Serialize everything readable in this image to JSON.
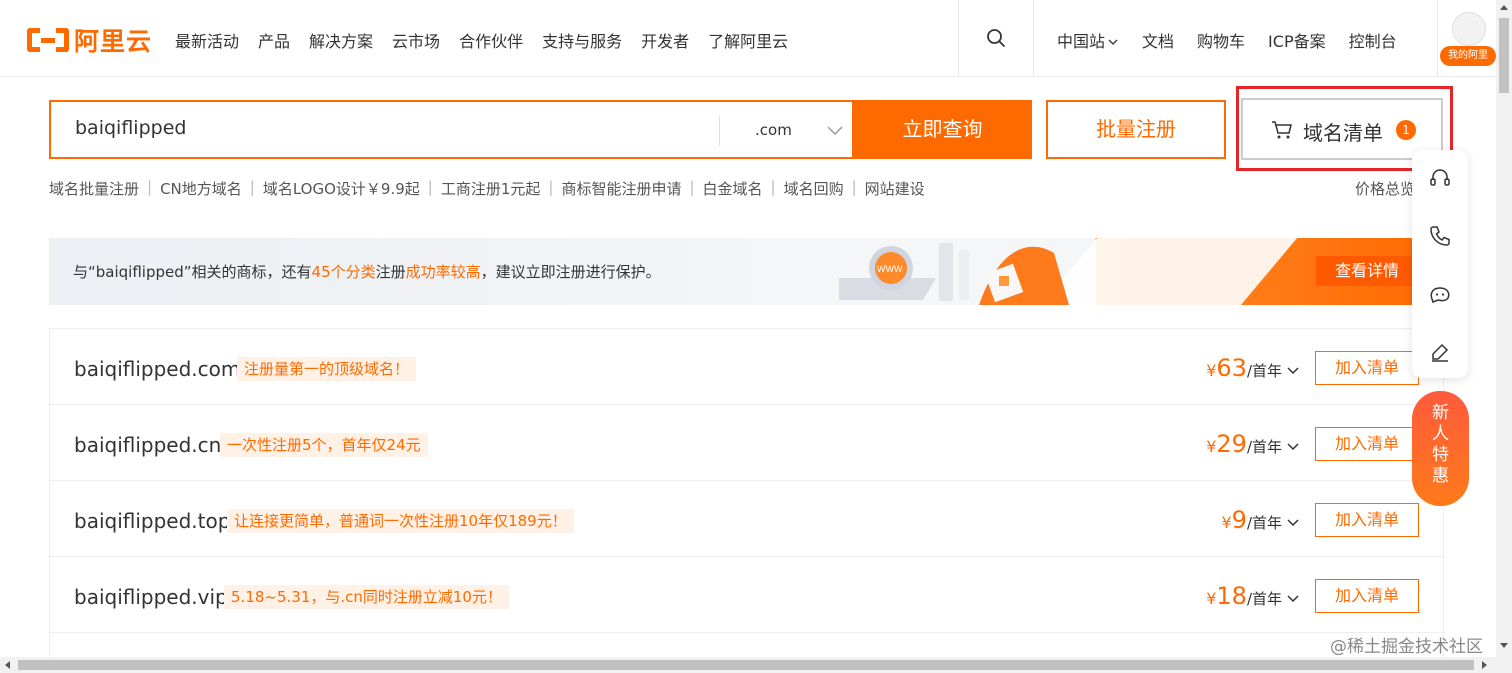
{
  "header": {
    "logo_text": "阿里云",
    "nav": [
      "最新活动",
      "产品",
      "解决方案",
      "云市场",
      "合作伙伴",
      "支持与服务",
      "开发者",
      "了解阿里云"
    ],
    "right_nav": [
      "中国站",
      "文档",
      "购物车",
      "ICP备案",
      "控制台"
    ],
    "avatar_badge": "我的阿里"
  },
  "search": {
    "value": "baiqiflipped",
    "suffix": ".com",
    "query_button": "立即查询",
    "batch_button": "批量注册",
    "list_button": "域名清单",
    "list_count": "1"
  },
  "links": [
    "域名批量注册",
    "CN地方域名",
    "域名LOGO设计￥9.9起",
    "工商注册1元起",
    "商标智能注册申请",
    "白金域名",
    "域名回购",
    "网站建设"
  ],
  "price_link": "价格总览",
  "banner": {
    "text_pre": "与“baiqiflipped”相关的商标，还有",
    "hl1": "45个分类",
    "text_mid": "注册",
    "hl2": "成功率较高",
    "text_post": "，建议立即注册进行保护。",
    "button": "查看详情",
    "art_label": "WWW"
  },
  "results": [
    {
      "name": "baiqiflipped.com",
      "tag": "注册量第一的顶级域名！",
      "currency": "¥",
      "price": "63",
      "unit": "/首年",
      "button": "加入清单"
    },
    {
      "name": "baiqiflipped.cn",
      "tag": "一次性注册5个，首年仅24元",
      "currency": "¥",
      "price": "29",
      "unit": "/首年",
      "button": "加入清单"
    },
    {
      "name": "baiqiflipped.top",
      "tag": "让连接更简单，普通词一次性注册10年仅189元！",
      "currency": "¥",
      "price": "9",
      "unit": "/首年",
      "button": "加入清单"
    },
    {
      "name": "baiqiflipped.vip",
      "tag": "5.18~5.31，与.cn同时注册立减10元！",
      "currency": "¥",
      "price": "18",
      "unit": "/首年",
      "button": "加入清单"
    }
  ],
  "float_tools": [
    "headset-icon",
    "phone-icon",
    "chat-icon",
    "edit-icon"
  ],
  "newbie": "新人特惠",
  "watermark": "@稀土掘金技术社区",
  "colors": {
    "accent": "#ff6a00",
    "highlight_border": "#e5252a"
  }
}
